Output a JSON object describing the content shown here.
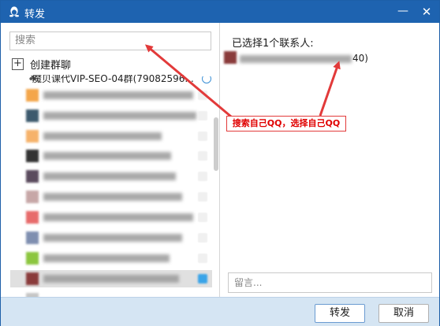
{
  "window": {
    "title": "转发"
  },
  "left": {
    "search_placeholder": "搜索",
    "create_group_label": "创建群聊",
    "first_contact_visible_text": "魔贝课代VIP-SEO-04群(79082596..."
  },
  "right": {
    "selected_header": "已选择1个联系人:",
    "selected_contact_suffix": "40)",
    "message_placeholder": "留言..."
  },
  "annotation": {
    "text": "搜索自己QQ，选择自己QQ",
    "color": "#e00000"
  },
  "footer": {
    "forward_label": "转发",
    "cancel_label": "取消"
  },
  "colors": {
    "titlebar": "#1e63b0",
    "footer": "#d5e5f3",
    "accent": "#3aa4e8",
    "annotation": "#e00000"
  },
  "icons": {
    "app": "qq-penguin-icon",
    "minimize": "minimize-icon",
    "close": "close-icon",
    "create_group": "plus-icon"
  }
}
